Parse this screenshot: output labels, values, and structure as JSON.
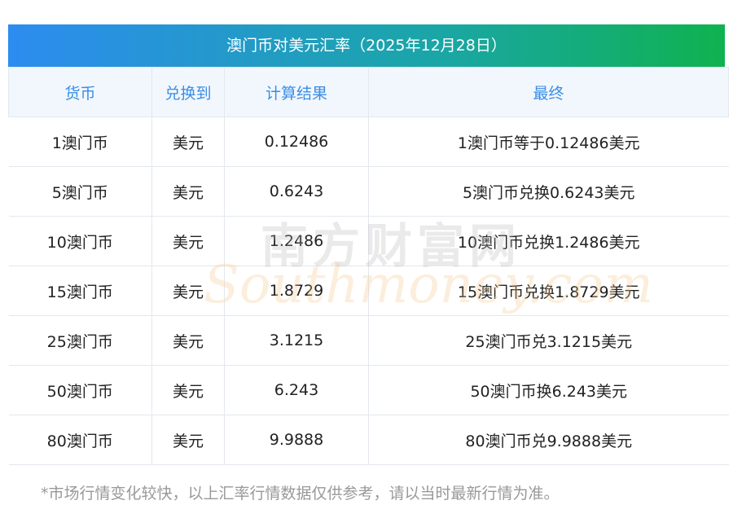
{
  "title": "澳门币对美元汇率（2025年12月28日）",
  "table": {
    "headers": [
      "货币",
      "兑换到",
      "计算结果",
      "最终"
    ],
    "rows": [
      [
        "1澳门币",
        "美元",
        "0.12486",
        "1澳门币等于0.12486美元"
      ],
      [
        "5澳门币",
        "美元",
        "0.6243",
        "5澳门币兑换0.6243美元"
      ],
      [
        "10澳门币",
        "美元",
        "1.2486",
        "10澳门币兑换1.2486美元"
      ],
      [
        "15澳门币",
        "美元",
        "1.8729",
        "15澳门币兑换1.8729美元"
      ],
      [
        "25澳门币",
        "美元",
        "3.1215",
        "25澳门币兑3.1215美元"
      ],
      [
        "50澳门币",
        "美元",
        "6.243",
        "50澳门币换6.243美元"
      ],
      [
        "80澳门币",
        "美元",
        "9.9888",
        "80澳门币兑9.9888美元"
      ]
    ]
  },
  "watermark": {
    "cn": "南方财富网",
    "en": "Southmoney.com"
  },
  "footnote": "*市场行情变化较快，以上汇率行情数据仅供参考，请以当时最新行情为准。",
  "colors": {
    "title_gradient_start": "#2d8cf0",
    "title_gradient_end": "#0fb24f",
    "header_text": "#3a8ee6",
    "header_bg": "#f2f7fd"
  }
}
